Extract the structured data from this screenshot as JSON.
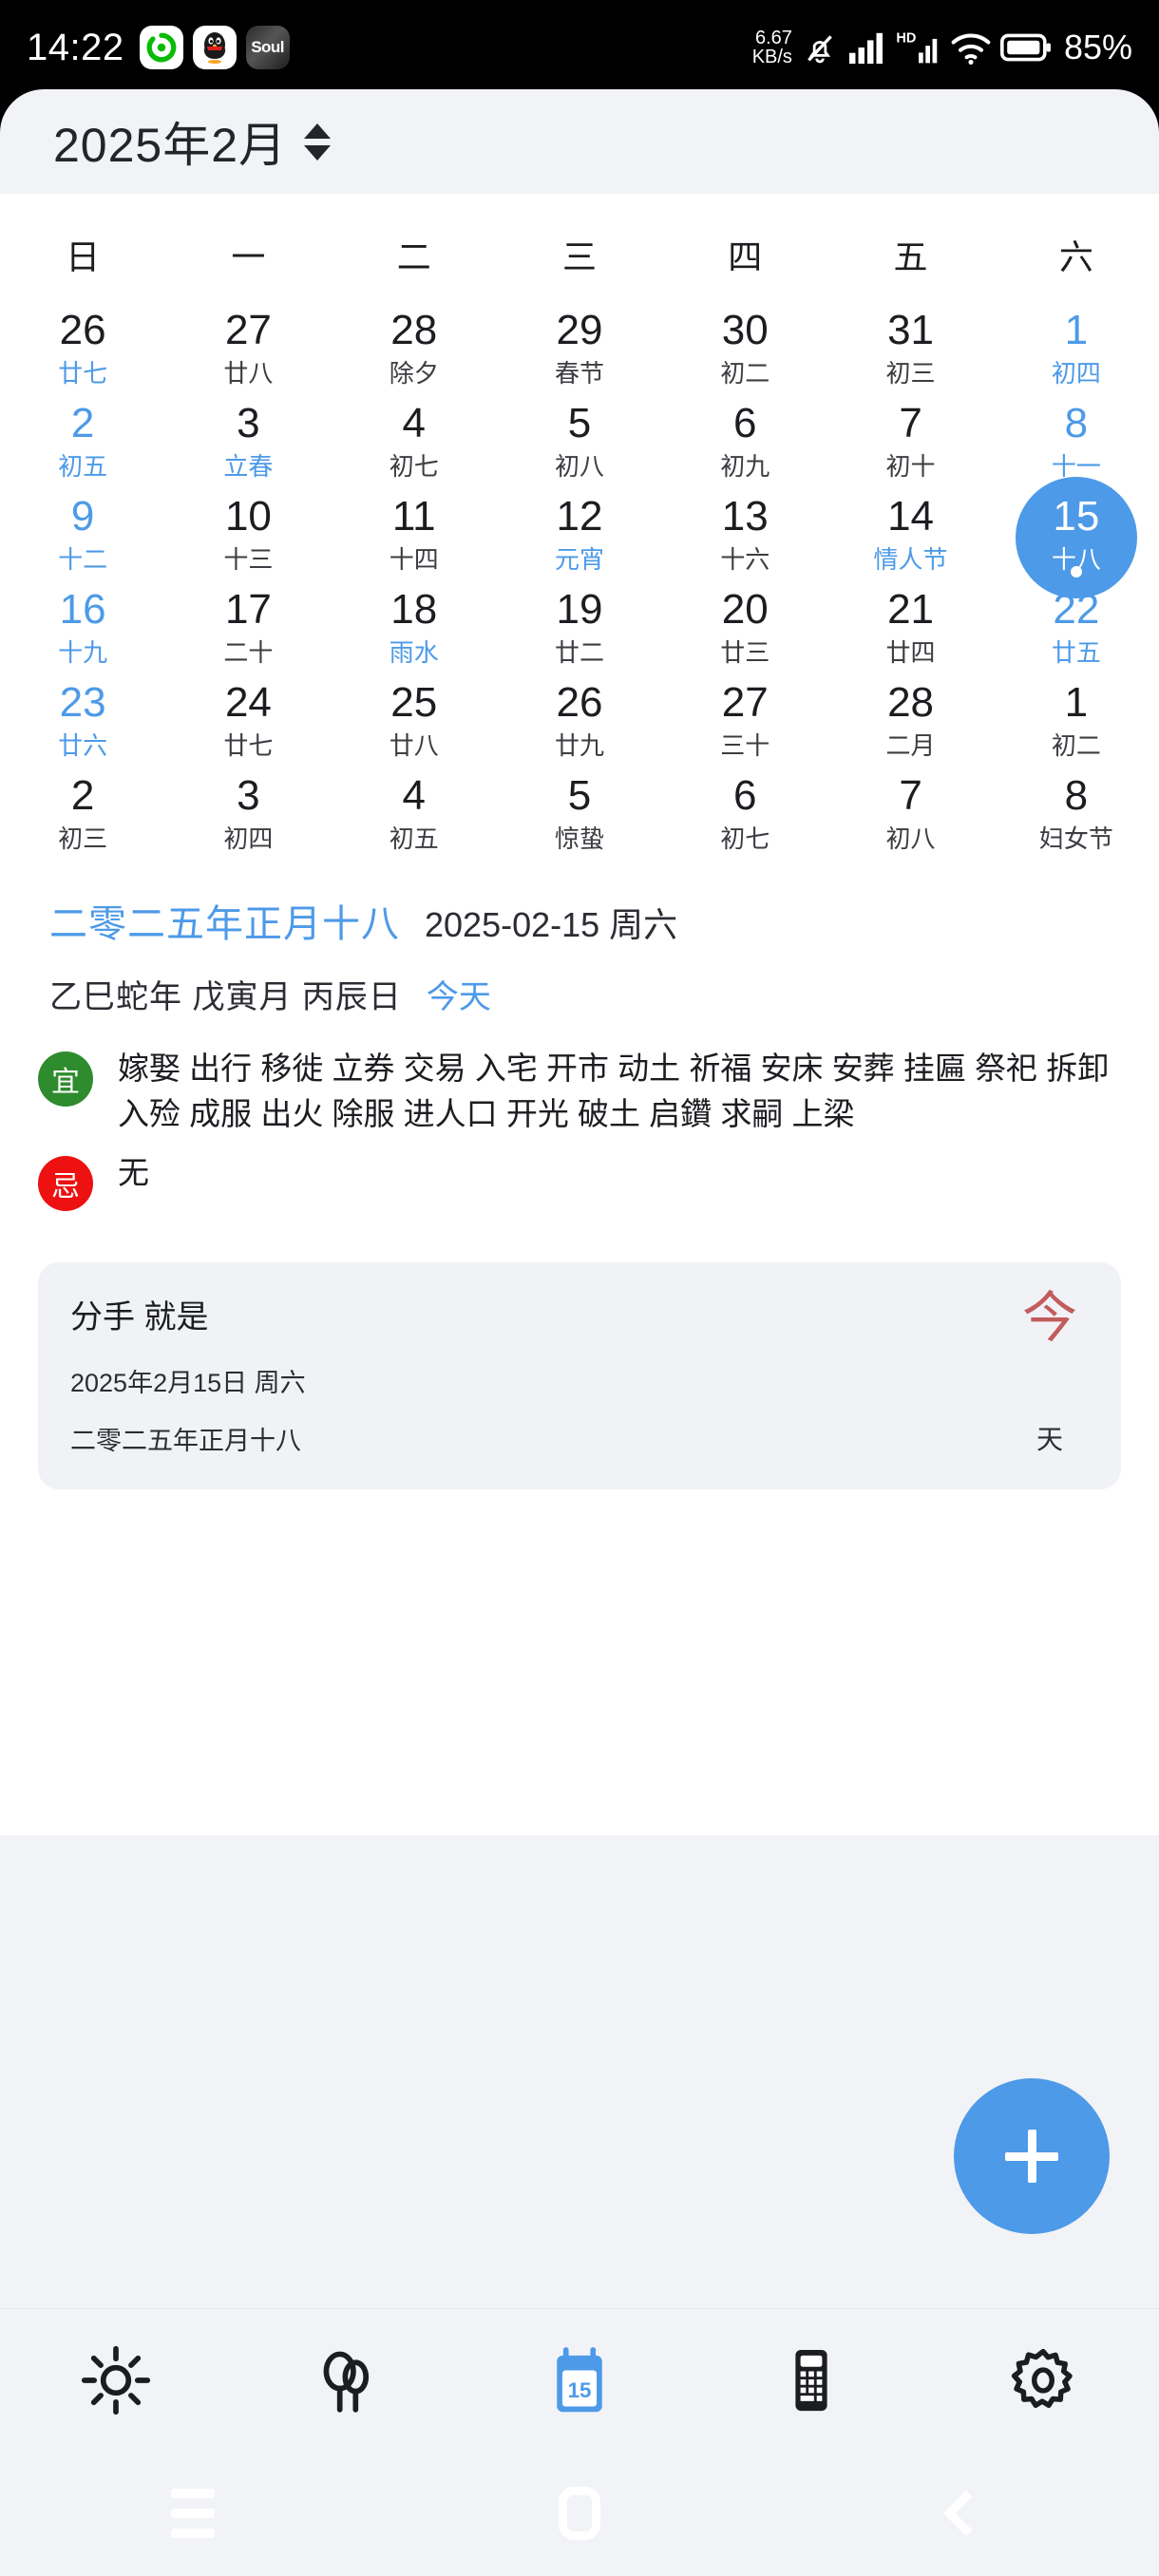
{
  "status_bar": {
    "time": "14:22",
    "app_icons": [
      "wechat-refresh-icon",
      "qq-penguin-icon",
      "soul-icon"
    ],
    "soul_label": "Soul",
    "net_speed_value": "6.67",
    "net_speed_unit": "KB/s",
    "mute_icon": "bell-muted-icon",
    "signal_icon": "signal-bars-icon",
    "hd_label": "HD",
    "signal2_icon": "signal-bars-icon",
    "wifi_icon": "wifi-icon",
    "battery_icon": "battery-icon",
    "battery_percent": "85%"
  },
  "header": {
    "title": "2025年2月",
    "selector_icon": "chevron-up-down-icon"
  },
  "calendar": {
    "weekdays": [
      "日",
      "一",
      "二",
      "三",
      "四",
      "五",
      "六"
    ],
    "weeks": [
      [
        {
          "num": "26",
          "lunar": "廿七",
          "weekend": true,
          "other": true
        },
        {
          "num": "27",
          "lunar": "廿八",
          "other": true
        },
        {
          "num": "28",
          "lunar": "除夕",
          "other": true
        },
        {
          "num": "29",
          "lunar": "春节",
          "other": true
        },
        {
          "num": "30",
          "lunar": "初二",
          "other": true
        },
        {
          "num": "31",
          "lunar": "初三",
          "other": true
        },
        {
          "num": "1",
          "lunar": "初四",
          "weekend": true
        }
      ],
      [
        {
          "num": "2",
          "lunar": "初五",
          "weekend": true
        },
        {
          "num": "3",
          "lunar": "立春",
          "festival": true
        },
        {
          "num": "4",
          "lunar": "初七"
        },
        {
          "num": "5",
          "lunar": "初八"
        },
        {
          "num": "6",
          "lunar": "初九"
        },
        {
          "num": "7",
          "lunar": "初十"
        },
        {
          "num": "8",
          "lunar": "十一",
          "weekend": true
        }
      ],
      [
        {
          "num": "9",
          "lunar": "十二",
          "weekend": true
        },
        {
          "num": "10",
          "lunar": "十三"
        },
        {
          "num": "11",
          "lunar": "十四"
        },
        {
          "num": "12",
          "lunar": "元宵",
          "festival": true
        },
        {
          "num": "13",
          "lunar": "十六"
        },
        {
          "num": "14",
          "lunar": "情人节",
          "festival": true
        },
        {
          "num": "15",
          "lunar": "十八",
          "selected": true,
          "has_event": true
        }
      ],
      [
        {
          "num": "16",
          "lunar": "十九",
          "weekend": true
        },
        {
          "num": "17",
          "lunar": "二十"
        },
        {
          "num": "18",
          "lunar": "雨水",
          "festival": true
        },
        {
          "num": "19",
          "lunar": "廿二"
        },
        {
          "num": "20",
          "lunar": "廿三"
        },
        {
          "num": "21",
          "lunar": "廿四"
        },
        {
          "num": "22",
          "lunar": "廿五",
          "weekend": true
        }
      ],
      [
        {
          "num": "23",
          "lunar": "廿六",
          "weekend": true
        },
        {
          "num": "24",
          "lunar": "廿七"
        },
        {
          "num": "25",
          "lunar": "廿八"
        },
        {
          "num": "26",
          "lunar": "廿九"
        },
        {
          "num": "27",
          "lunar": "三十"
        },
        {
          "num": "28",
          "lunar": "二月"
        },
        {
          "num": "1",
          "lunar": "初二",
          "other": true
        }
      ],
      [
        {
          "num": "2",
          "lunar": "初三",
          "other": true
        },
        {
          "num": "3",
          "lunar": "初四",
          "other": true
        },
        {
          "num": "4",
          "lunar": "初五",
          "other": true
        },
        {
          "num": "5",
          "lunar": "惊蛰",
          "other": true
        },
        {
          "num": "6",
          "lunar": "初七",
          "other": true
        },
        {
          "num": "7",
          "lunar": "初八",
          "other": true
        },
        {
          "num": "8",
          "lunar": "妇女节",
          "other": true
        }
      ]
    ]
  },
  "detail": {
    "lunar_long": "二零二五年正月十八",
    "gregorian_long": "2025-02-15 周六",
    "ganzhi": "乙巳蛇年 戊寅月 丙辰日",
    "today_link": "今天",
    "yi_label": "宜",
    "yi_text": "嫁娶 出行 移徙 立券 交易 入宅 开市 动土 祈福 安床 安葬 挂匾 祭祀 拆卸 入殓 成服 出火 除服 进人口 开光 破土 启鑽 求嗣 上梁",
    "ji_label": "忌",
    "ji_text": "无"
  },
  "event_card": {
    "title": "分手 就是",
    "date": "2025年2月15日 周六",
    "lunar": "二零二五年正月十八",
    "count_big": "今",
    "count_unit": "天"
  },
  "fab": {
    "icon": "plus-icon"
  },
  "bottom_nav": {
    "items": [
      {
        "icon": "sun-weather-icon",
        "active": false
      },
      {
        "icon": "balloons-icon",
        "active": false
      },
      {
        "icon": "calendar-15-icon",
        "active": true,
        "day": "15"
      },
      {
        "icon": "calculator-icon",
        "active": false
      },
      {
        "icon": "gear-settings-icon",
        "active": false
      }
    ]
  },
  "system_nav": {
    "recents_icon": "menu-recents-icon",
    "home_icon": "home-icon",
    "back_icon": "back-chevron-icon"
  },
  "colors": {
    "accent_blue": "#4d9ae8",
    "app_bg": "#f2f3f7",
    "card_bg": "#ffffff",
    "yi_green": "#2e8b2e",
    "ji_red": "#ee1111",
    "event_red": "#c25c5c"
  }
}
